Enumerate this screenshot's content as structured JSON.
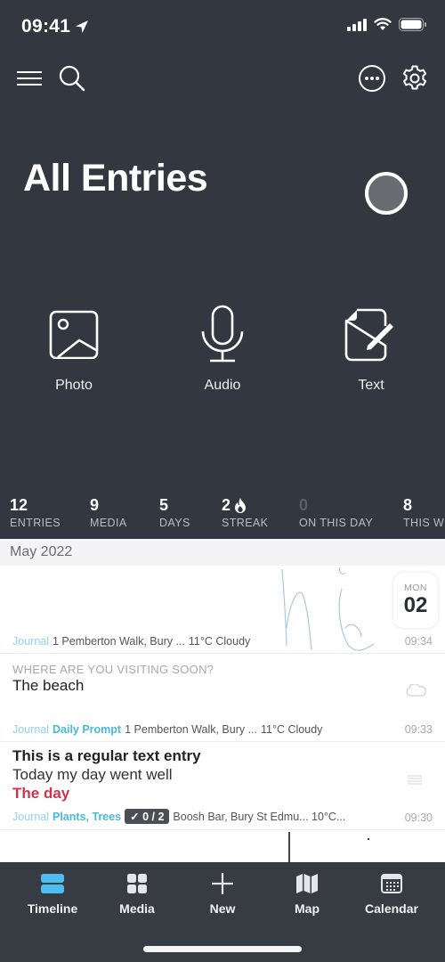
{
  "status_bar": {
    "time": "09:41"
  },
  "header": {
    "title": "All Entries"
  },
  "quick_actions": [
    {
      "label": "Photo",
      "icon": "photo-icon"
    },
    {
      "label": "Audio",
      "icon": "microphone-icon"
    },
    {
      "label": "Text",
      "icon": "document-edit-icon"
    }
  ],
  "stats": [
    {
      "value": "12",
      "label": "ENTRIES"
    },
    {
      "value": "9",
      "label": "MEDIA"
    },
    {
      "value": "5",
      "label": "DAYS"
    },
    {
      "value": "2",
      "label": "STREAK",
      "icon": "flame-icon"
    },
    {
      "value": "0",
      "label": "ON THIS DAY"
    },
    {
      "value": "8",
      "label": "THIS WEEK"
    }
  ],
  "timeline": {
    "month": "May 2022",
    "entries": [
      {
        "type": "drawing",
        "date_badge": {
          "weekday": "MON",
          "day": "02"
        },
        "journal": "Journal",
        "location": "1 Pemberton Walk, Bury ...",
        "weather": "11°C Cloudy",
        "time": "09:34"
      },
      {
        "type": "prompt",
        "question": "WHERE ARE YOU VISITING SOON?",
        "answer": "The beach",
        "journal": "Journal",
        "tags": "Daily Prompt",
        "location": "1 Pemberton Walk, Bury ...",
        "weather": "11°C Cloudy",
        "time": "09:33"
      },
      {
        "type": "text",
        "title": "This is a regular text entry",
        "line": "Today my day went well",
        "highlight": "The day",
        "journal": "Journal",
        "tags": "Plants, Trees",
        "todo": "✓ 0 / 2",
        "location": "Boosh Bar, Bury St Edmu... 10°C...",
        "time": "09:30"
      }
    ]
  },
  "tabbar": {
    "active": "Timeline",
    "tabs": [
      {
        "label": "Timeline",
        "icon": "timeline-icon"
      },
      {
        "label": "Media",
        "icon": "grid-icon"
      },
      {
        "label": "New",
        "icon": "plus-icon"
      },
      {
        "label": "Map",
        "icon": "map-icon"
      },
      {
        "label": "Calendar",
        "icon": "calendar-icon"
      }
    ]
  },
  "colors": {
    "background": "#333840",
    "accent": "#4ab8da",
    "active_tab": "#4cbfef",
    "highlight_red": "#d0344a"
  }
}
